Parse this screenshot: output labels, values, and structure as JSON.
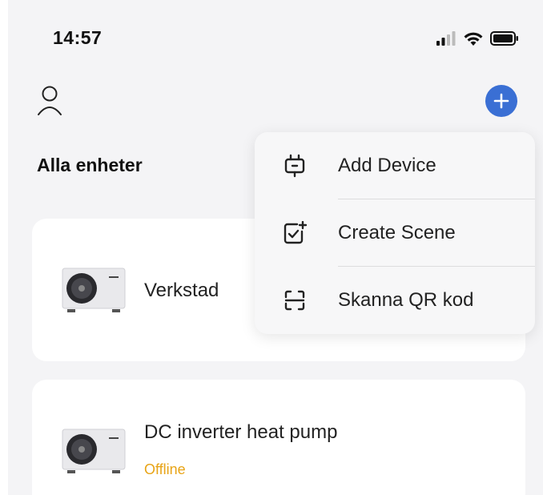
{
  "status_bar": {
    "time": "14:57",
    "icons": [
      "cellular-signal-icon",
      "wifi-icon",
      "battery-icon"
    ]
  },
  "header": {
    "user_icon": "user-icon",
    "add_icon": "plus-icon"
  },
  "section": {
    "title": "Alla enheter"
  },
  "devices": [
    {
      "name": "Verkstad",
      "status": "",
      "icon": "heat-pump-image"
    },
    {
      "name": "DC inverter heat pump",
      "status": "Offline",
      "icon": "heat-pump-image"
    }
  ],
  "menu": {
    "items": [
      {
        "label": "Add Device",
        "icon": "add-device-icon"
      },
      {
        "label": "Create Scene",
        "icon": "create-scene-icon"
      },
      {
        "label": "Skanna QR kod",
        "icon": "scan-qr-icon"
      }
    ]
  },
  "colors": {
    "accent": "#3a6fd4",
    "offline": "#e8a417",
    "background": "#f4f4f6",
    "card": "#ffffff"
  }
}
